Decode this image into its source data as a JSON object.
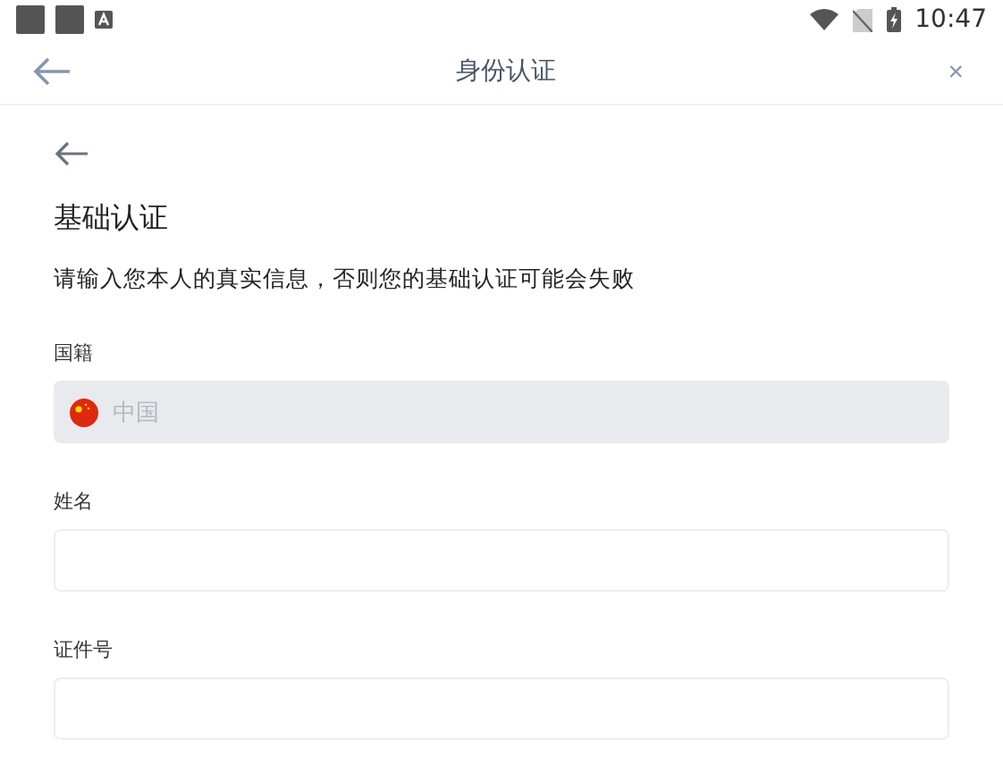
{
  "status_bar": {
    "time": "10:47"
  },
  "header": {
    "title": "身份认证",
    "close": "×"
  },
  "page": {
    "title": "基础认证",
    "subtitle": "请输入您本人的真实信息，否则您的基础认证可能会失败"
  },
  "fields": [
    {
      "label": "国籍",
      "value": "中国",
      "disabled": true,
      "kind": "country"
    },
    {
      "label": "姓名",
      "disabled": false,
      "kind": "text"
    },
    {
      "label": "证件号",
      "disabled": false,
      "kind": "text"
    }
  ]
}
